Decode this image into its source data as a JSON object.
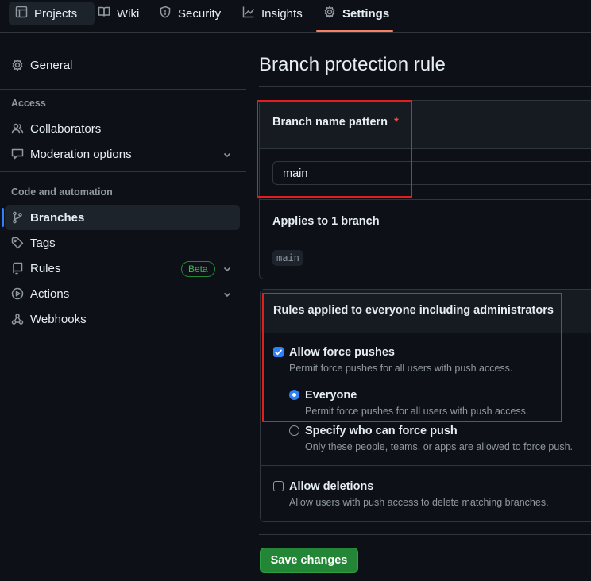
{
  "topnav": {
    "tabs": [
      {
        "label": "Projects",
        "icon": "table-icon"
      },
      {
        "label": "Wiki",
        "icon": "book-icon"
      },
      {
        "label": "Security",
        "icon": "shield-icon"
      },
      {
        "label": "Insights",
        "icon": "graph-icon"
      },
      {
        "label": "Settings",
        "icon": "gear-icon",
        "selected": true
      }
    ]
  },
  "sidebar": {
    "general": "General",
    "access_heading": "Access",
    "collaborators": "Collaborators",
    "moderation": "Moderation options",
    "code_heading": "Code and automation",
    "branches": "Branches",
    "tags": "Tags",
    "rules": "Rules",
    "rules_badge": "Beta",
    "actions": "Actions",
    "webhooks": "Webhooks"
  },
  "main": {
    "title": "Branch protection rule",
    "pattern_label": "Branch name pattern",
    "required_mark": "*",
    "pattern_value": "main",
    "applies_label": "Applies to 1 branch",
    "applies_branch": "main",
    "rules_heading": "Rules applied to everyone including administrators",
    "force_push_label": "Allow force pushes",
    "force_push_checked": true,
    "force_push_desc": "Permit force pushes for all users with push access.",
    "everyone_label": "Everyone",
    "everyone_selected": true,
    "everyone_desc": "Permit force pushes for all users with push access.",
    "specify_label": "Specify who can force push",
    "specify_selected": false,
    "specify_desc": "Only these people, teams, or apps are allowed to force push.",
    "deletions_label": "Allow deletions",
    "deletions_checked": false,
    "deletions_desc": "Allow users with push access to delete matching branches.",
    "save_label": "Save changes"
  },
  "colors": {
    "background": "#0d1117",
    "accent_blue": "#2f81f7",
    "tab_underline": "#f78166",
    "save_green": "#238636",
    "highlight_red": "#e01e1e",
    "beta_green": "#3fb950"
  }
}
